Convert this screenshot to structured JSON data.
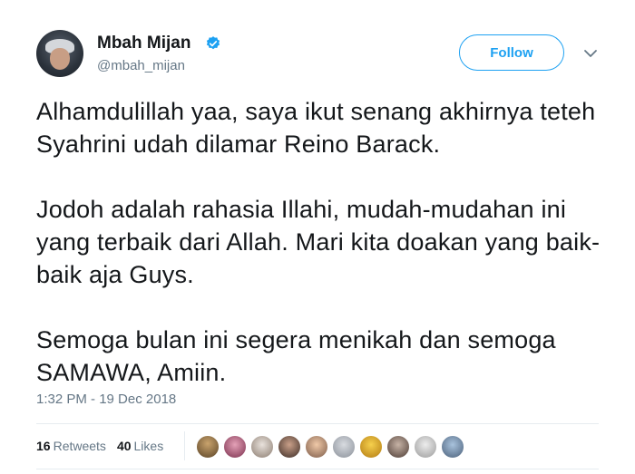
{
  "author": {
    "name": "Mbah Mijan",
    "handle": "@mbah_mijan",
    "verified_icon": "verified-badge-icon"
  },
  "actions": {
    "follow_label": "Follow",
    "menu_icon": "chevron-down-icon"
  },
  "tweet": {
    "paragraphs": [
      "Alhamdulillah yaa, saya ikut senang akhirnya teteh Syahrini udah dilamar Reino Barack.",
      "Jodoh adalah rahasia Illahi, mudah-mudahan ini yang terbaik dari Allah. Mari kita doakan yang baik-baik aja Guys.",
      "Semoga bulan ini segera menikah dan semoga SAMAWA, Amiin."
    ],
    "timestamp": "1:32 PM - 19 Dec 2018"
  },
  "stats": {
    "retweets_count": "16",
    "retweets_label": "Retweets",
    "likes_count": "40",
    "likes_label": "Likes"
  },
  "likers_count_shown": 10,
  "colors": {
    "accent": "#1da1f2",
    "text": "#14171a",
    "muted": "#657786",
    "divider": "#e6ecf0"
  }
}
